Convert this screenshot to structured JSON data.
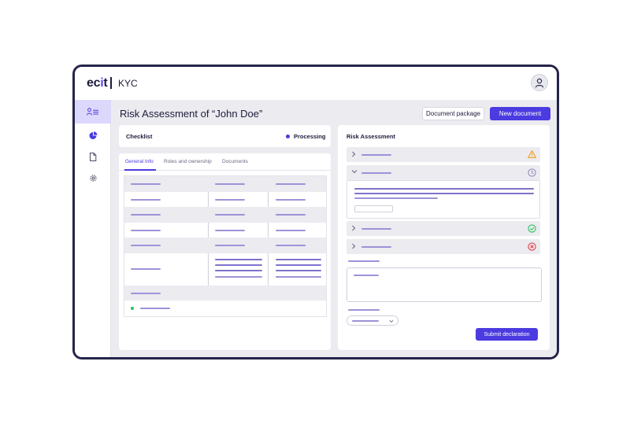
{
  "brand": {
    "logo_prefix": "ec",
    "logo_accent": "i",
    "logo_suffix": "t",
    "app_name": "KYC"
  },
  "sidebar": {
    "items": [
      {
        "icon": "user-list-icon",
        "active": true
      },
      {
        "icon": "pie-chart-icon",
        "active": false
      },
      {
        "icon": "document-icon",
        "active": false
      },
      {
        "icon": "gear-icon",
        "active": false
      }
    ]
  },
  "header": {
    "title": "Risk Assessment of “John Doe”",
    "document_package_label": "Document package",
    "new_document_label": "New document"
  },
  "checklist": {
    "title": "Checklist",
    "status": "Processing",
    "status_color": "#4b3be0",
    "tabs": [
      "General Info",
      "Roles and ownership",
      "Documents"
    ],
    "active_tab": 0
  },
  "risk_assessment": {
    "title": "Risk Assessment",
    "items": [
      {
        "status_icon": "warning-icon",
        "status_color": "#f0a020",
        "expanded": false
      },
      {
        "status_icon": "clock-icon",
        "status_color": "#8a84b8",
        "expanded": true
      },
      {
        "status_icon": "check-circle-icon",
        "status_color": "#2fbf5a",
        "expanded": false
      },
      {
        "status_icon": "error-circle-icon",
        "status_color": "#e0414b",
        "expanded": false
      }
    ],
    "submit_label": "Submit declaration"
  },
  "colors": {
    "accent": "#4b3be0",
    "frame": "#24244a",
    "background": "#ebebf0"
  }
}
